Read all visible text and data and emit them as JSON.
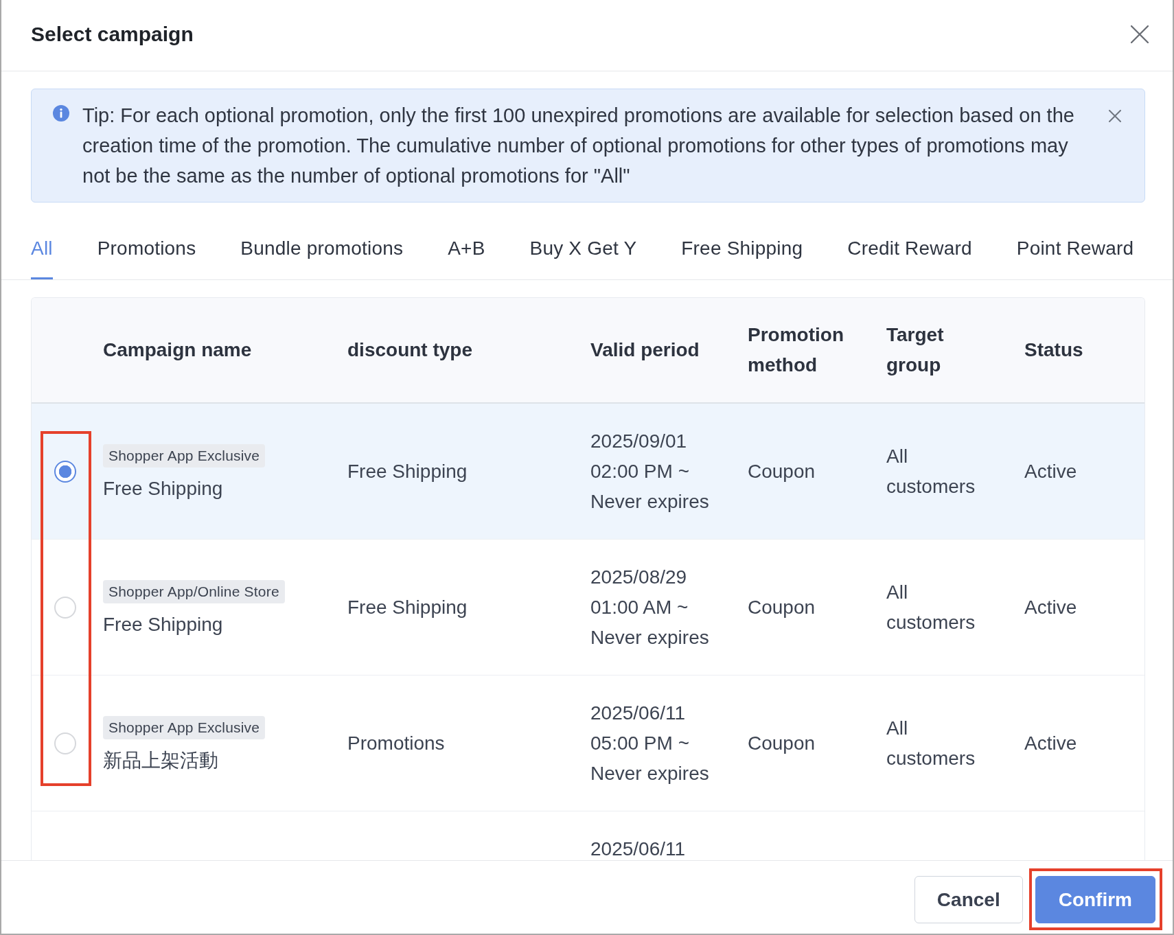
{
  "dialog": {
    "title": "Select campaign"
  },
  "tip": {
    "text": "Tip: For each optional promotion, only the first 100 unexpired promotions are available for selection based on the creation time of the promotion. The cumulative number of optional promotions for other types of promotions may not be the same as the number of optional promotions for \"All\""
  },
  "tabs": [
    {
      "label": "All",
      "selected": true
    },
    {
      "label": "Promotions",
      "selected": false
    },
    {
      "label": "Bundle promotions",
      "selected": false
    },
    {
      "label": "A+B",
      "selected": false
    },
    {
      "label": "Buy X Get Y",
      "selected": false
    },
    {
      "label": "Free Shipping",
      "selected": false
    },
    {
      "label": "Credit Reward",
      "selected": false
    },
    {
      "label": "Point Reward",
      "selected": false
    }
  ],
  "table": {
    "columns": [
      "Campaign name",
      "discount type",
      "Valid period",
      "Promotion method",
      "Target group",
      "Status"
    ],
    "selection_highlighted": true,
    "rows": [
      {
        "selected": true,
        "tag": "Shopper App Exclusive",
        "name": "Free Shipping",
        "discount_type": "Free Shipping",
        "valid_period": "2025/09/01 02:00 PM ~ Never expires",
        "promotion_method": "Coupon",
        "target_group": "All customers",
        "status": "Active"
      },
      {
        "selected": false,
        "tag": "Shopper App/Online Store",
        "name": "Free Shipping",
        "discount_type": "Free Shipping",
        "valid_period": "2025/08/29 01:00 AM ~ Never expires",
        "promotion_method": "Coupon",
        "target_group": "All customers",
        "status": "Active"
      },
      {
        "selected": false,
        "tag": "Shopper App Exclusive",
        "name": "新品上架活動",
        "discount_type": "Promotions",
        "valid_period": "2025/06/11 05:00 PM ~ Never expires",
        "promotion_method": "Coupon",
        "target_group": "All customers",
        "status": "Active"
      }
    ],
    "partial_row": {
      "valid_period": "2025/06/11"
    }
  },
  "buttons": [
    {
      "label": "Cancel",
      "kind": "secondary",
      "highlighted": false
    },
    {
      "label": "Confirm",
      "kind": "primary",
      "highlighted": true
    }
  ]
}
